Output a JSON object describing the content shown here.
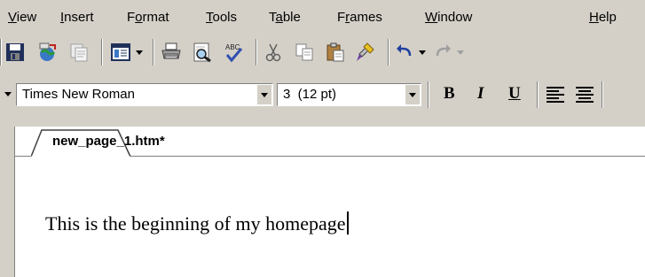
{
  "menubar": {
    "items": [
      {
        "pre": "",
        "key": "V",
        "post": "iew"
      },
      {
        "pre": "",
        "key": "I",
        "post": "nsert"
      },
      {
        "pre": "F",
        "key": "o",
        "post": "rmat"
      },
      {
        "pre": "",
        "key": "T",
        "post": "ools"
      },
      {
        "pre": "T",
        "key": "a",
        "post": "ble"
      },
      {
        "pre": "F",
        "key": "r",
        "post": "ames"
      },
      {
        "pre": "",
        "key": "W",
        "post": "indow"
      },
      {
        "pre": "",
        "key": "H",
        "post": "elp"
      }
    ]
  },
  "standard_toolbar": {
    "icons": [
      "save-icon",
      "publish-icon",
      "preview-in-browser-icon",
      "folder-list-icon",
      "print-icon",
      "print-preview-icon",
      "spelling-icon",
      "cut-icon",
      "copy-icon",
      "paste-icon",
      "format-painter-icon",
      "undo-icon",
      "redo-icon"
    ]
  },
  "formatting_toolbar": {
    "font_name": "Times New Roman",
    "font_size": "3  (12 pt)",
    "bold_label": "B",
    "italic_label": "I",
    "underline_label": "U"
  },
  "editor": {
    "tab_label": "new_page_1.htm*",
    "content": "This is the beginning of my homepage"
  }
}
